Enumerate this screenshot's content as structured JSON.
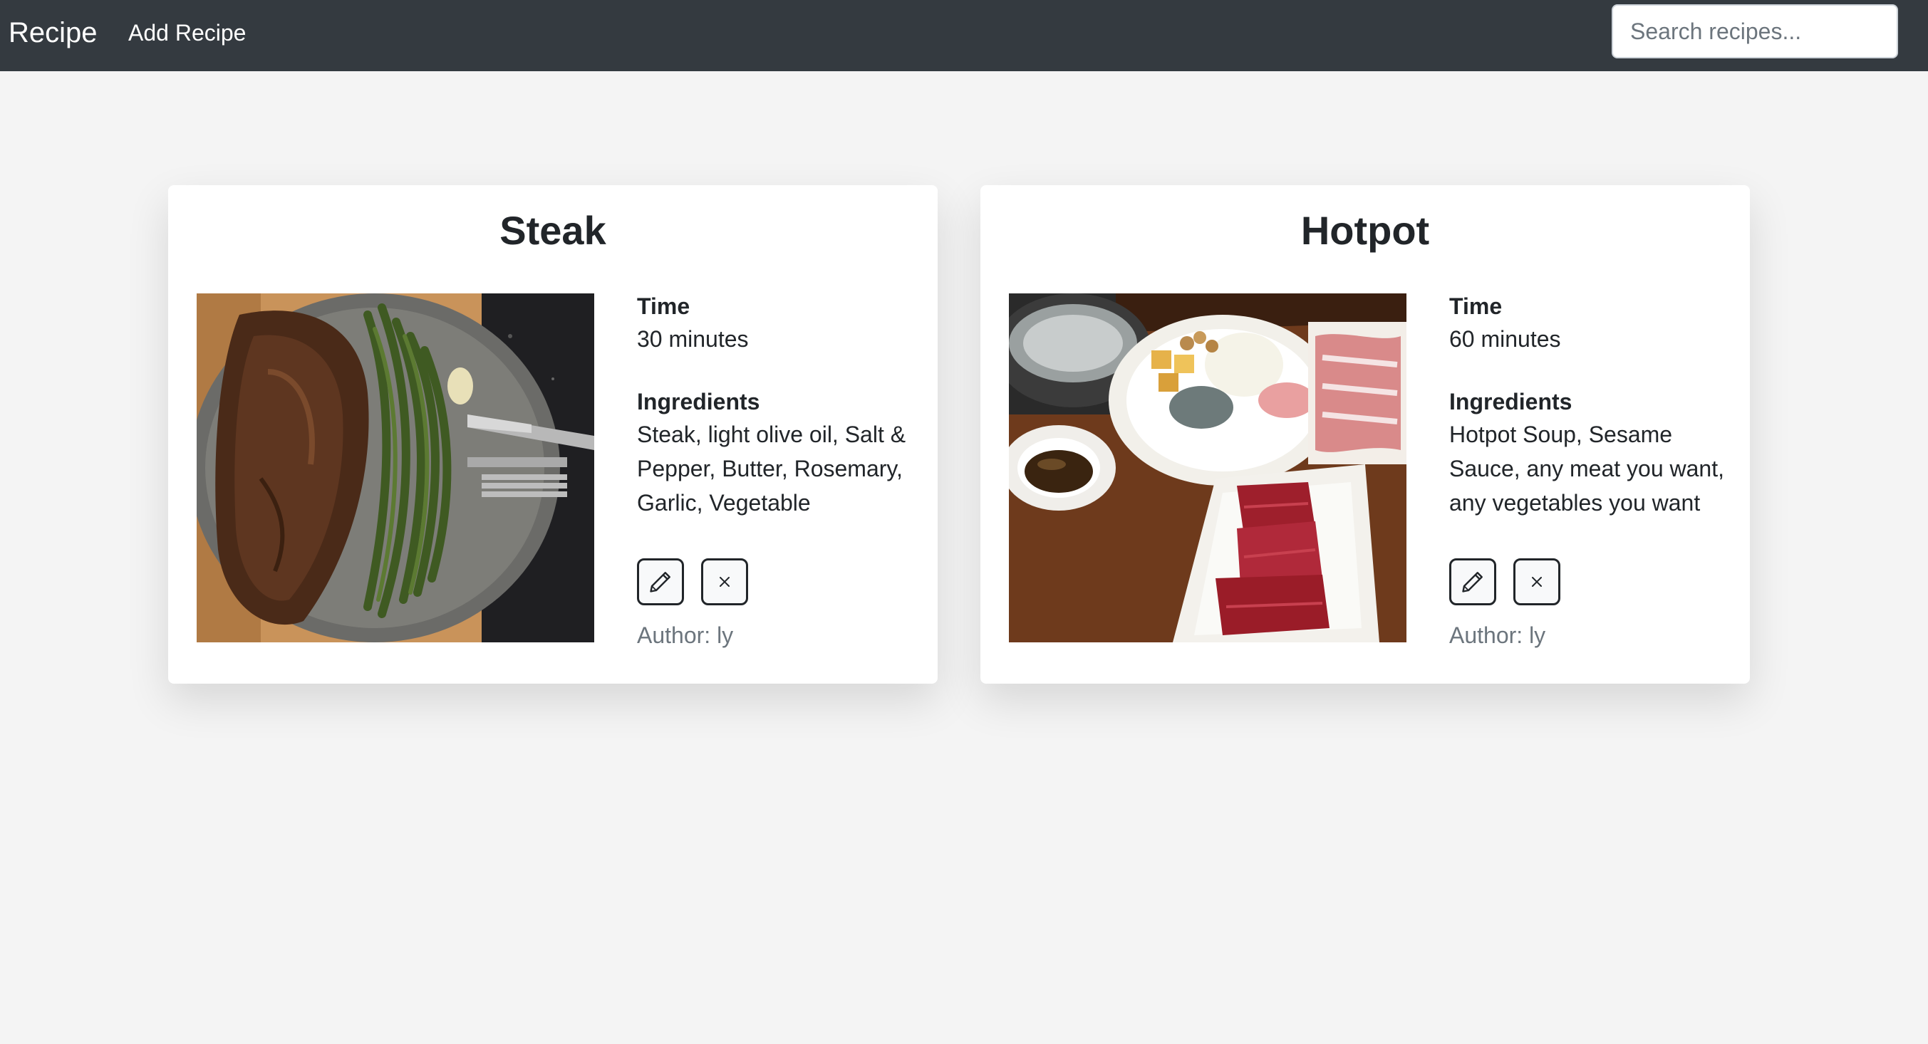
{
  "navbar": {
    "brand": "Recipe",
    "add_recipe_label": "Add Recipe",
    "search_placeholder": "Search recipes..."
  },
  "recipes": [
    {
      "title": "Steak",
      "time_label": "Time",
      "time_value": "30 minutes",
      "ingredients_label": "Ingredients",
      "ingredients_value": "Steak, light olive oil, Salt & Pepper, Butter, Rosemary, Garlic, Vegetable",
      "author": "Author: ly",
      "photo_icon": "steak-photo"
    },
    {
      "title": "Hotpot",
      "time_label": "Time",
      "time_value": "60 minutes",
      "ingredients_label": "Ingredients",
      "ingredients_value": "Hotpot Soup, Sesame Sauce, any meat you want, any vegetables you want",
      "author": "Author: ly",
      "photo_icon": "hotpot-photo"
    }
  ],
  "icons": {
    "edit": "pencil-icon",
    "delete": "close-icon"
  },
  "colors": {
    "navbar": "#343a40",
    "background": "#f4f4f4",
    "author_text": "#6c757d"
  }
}
